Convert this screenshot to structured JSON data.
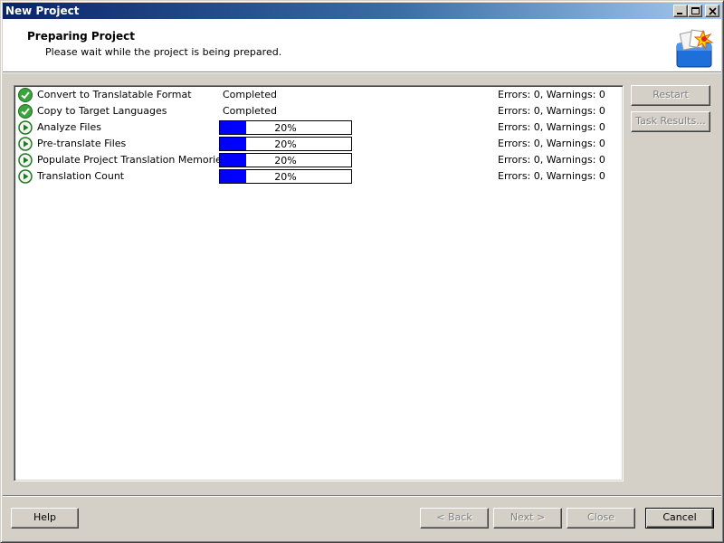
{
  "window": {
    "title": "New Project"
  },
  "header": {
    "title": "Preparing Project",
    "subtitle": "Please wait while the project is being prepared."
  },
  "tasks": [
    {
      "name": "Convert to Translatable Format",
      "state": "completed",
      "status": "Completed",
      "errors": "Errors: 0, Warnings: 0"
    },
    {
      "name": "Copy to Target Languages",
      "state": "completed",
      "status": "Completed",
      "errors": "Errors: 0, Warnings: 0"
    },
    {
      "name": "Analyze Files",
      "state": "running",
      "progress": 0.2,
      "progress_label": "20%",
      "errors": "Errors: 0, Warnings: 0"
    },
    {
      "name": "Pre-translate Files",
      "state": "running",
      "progress": 0.2,
      "progress_label": "20%",
      "errors": "Errors: 0, Warnings: 0"
    },
    {
      "name": "Populate Project Translation Memories",
      "state": "running",
      "progress": 0.2,
      "progress_label": "20%",
      "errors": "Errors: 0, Warnings: 0"
    },
    {
      "name": "Translation Count",
      "state": "running",
      "progress": 0.2,
      "progress_label": "20%",
      "errors": "Errors: 0, Warnings: 0"
    }
  ],
  "side_buttons": {
    "restart": "Restart",
    "task_results": "Task Results..."
  },
  "footer_buttons": {
    "help": "Help",
    "back": "< Back",
    "next": "Next >",
    "close": "Close",
    "cancel": "Cancel"
  },
  "colors": {
    "progress_fill": "#0000ff",
    "completed_icon": "#3aa53a",
    "running_icon": "#1e7a1e"
  }
}
